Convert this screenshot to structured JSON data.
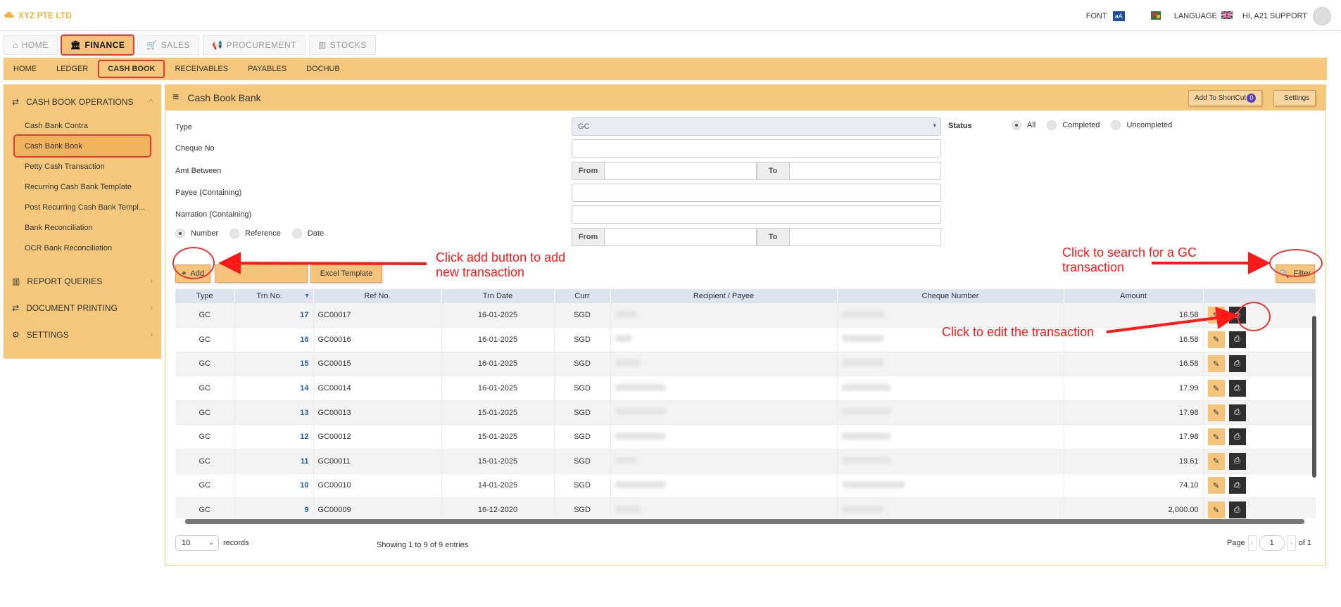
{
  "topbar": {
    "brand": "XYZ PTE LTD",
    "font_label": "FONT",
    "font_icon_text": "aA",
    "language_label": "LANGUAGE",
    "user_greeting": "HI, A21 SUPPORT"
  },
  "main_tabs": [
    {
      "label": "HOME",
      "icon": "home-icon"
    },
    {
      "label": "FINANCE",
      "icon": "bank-icon"
    },
    {
      "label": "SALES",
      "icon": "cart-icon"
    },
    {
      "label": "PROCUREMENT",
      "icon": "megaphone-icon"
    },
    {
      "label": "STOCKS",
      "icon": "bar-chart-icon"
    }
  ],
  "sub_nav": [
    "HOME",
    "LEDGER",
    "CASH BOOK",
    "RECEIVABLES",
    "PAYABLES",
    "DOCHUB"
  ],
  "sidebar": {
    "section_operations": "CASH BOOK OPERATIONS",
    "items": [
      "Cash Bank Contra",
      "Cash Bank Book",
      "Petty Cash Transaction",
      "Recurring Cash Bank Template",
      "Post Recurring Cash Bank Templ...",
      "Bank Reconciliation",
      "OCR Bank Reconciliation"
    ],
    "section_reports": "REPORT QUERIES",
    "section_printing": "DOCUMENT PRINTING",
    "section_settings": "SETTINGS"
  },
  "panel": {
    "title": "Cash Book Bank",
    "shortcut_label": "Add To ShortCut",
    "shortcut_count": "0",
    "settings_label": "Settings"
  },
  "form": {
    "type_label": "Type",
    "type_value": "GC",
    "cheque_label": "Cheque No",
    "amt_label": "Amt Between",
    "payee_label": "Payee (Containing)",
    "narration_label": "Narration (Containing)",
    "from_label": "From",
    "to_label": "To",
    "sort_options": [
      "Number",
      "Reference",
      "Date"
    ],
    "status_label": "Status",
    "status_options": [
      "All",
      "Completed",
      "Uncompleted"
    ]
  },
  "buttons": {
    "add": "Add",
    "excel_template": "Excel Template",
    "filter": "Filter"
  },
  "table": {
    "headers": [
      "Type",
      "Trn No.",
      "Ref No.",
      "Trn Date",
      "Curr",
      "Recipient / Payee",
      "Cheque Number",
      "Amount"
    ],
    "rows": [
      {
        "type": "GC",
        "trn": "17",
        "ref": "GC00017",
        "date": "16-01-2025",
        "curr": "SGD",
        "amount": "16.58"
      },
      {
        "type": "GC",
        "trn": "16",
        "ref": "GC00016",
        "date": "16-01-2025",
        "curr": "SGD",
        "amount": "16.58"
      },
      {
        "type": "GC",
        "trn": "15",
        "ref": "GC00015",
        "date": "16-01-2025",
        "curr": "SGD",
        "amount": "16.58"
      },
      {
        "type": "GC",
        "trn": "14",
        "ref": "GC00014",
        "date": "16-01-2025",
        "curr": "SGD",
        "amount": "17.99"
      },
      {
        "type": "GC",
        "trn": "13",
        "ref": "GC00013",
        "date": "15-01-2025",
        "curr": "SGD",
        "amount": "17.98"
      },
      {
        "type": "GC",
        "trn": "12",
        "ref": "GC00012",
        "date": "15-01-2025",
        "curr": "SGD",
        "amount": "17.98"
      },
      {
        "type": "GC",
        "trn": "11",
        "ref": "GC00011",
        "date": "15-01-2025",
        "curr": "SGD",
        "amount": "19.61"
      },
      {
        "type": "GC",
        "trn": "10",
        "ref": "GC00010",
        "date": "14-01-2025",
        "curr": "SGD",
        "amount": "74.10"
      },
      {
        "type": "GC",
        "trn": "9",
        "ref": "GC00009",
        "date": "16-12-2020",
        "curr": "SGD",
        "amount": "2,000.00"
      }
    ]
  },
  "footer": {
    "page_size": "10",
    "records_label": "records",
    "showing": "Showing 1 to 9 of 9 entries",
    "page_label": "Page",
    "page_value": "1",
    "of_label": "of 1"
  },
  "annotations": {
    "add": "Click add button to add new transaction",
    "filter": "Click to search for a GC transaction",
    "edit": "Click to edit the transaction"
  },
  "colors": {
    "accent": "#f6c87c",
    "highlight": "#e53935",
    "annotation": "#ff1a1a",
    "link": "#1f5fa8"
  }
}
